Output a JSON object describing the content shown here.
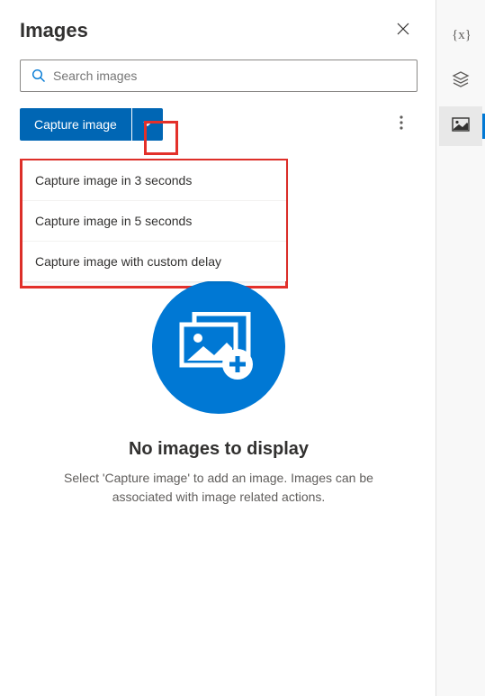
{
  "header": {
    "title": "Images"
  },
  "search": {
    "placeholder": "Search images"
  },
  "toolbar": {
    "capture_label": "Capture image"
  },
  "dropdown": {
    "items": [
      {
        "label": "Capture image in 3 seconds"
      },
      {
        "label": "Capture image in 5 seconds"
      },
      {
        "label": "Capture image with custom delay"
      }
    ]
  },
  "empty": {
    "title": "No images to display",
    "subtitle": "Select 'Capture image' to add an image. Images can be associated with image related actions."
  }
}
